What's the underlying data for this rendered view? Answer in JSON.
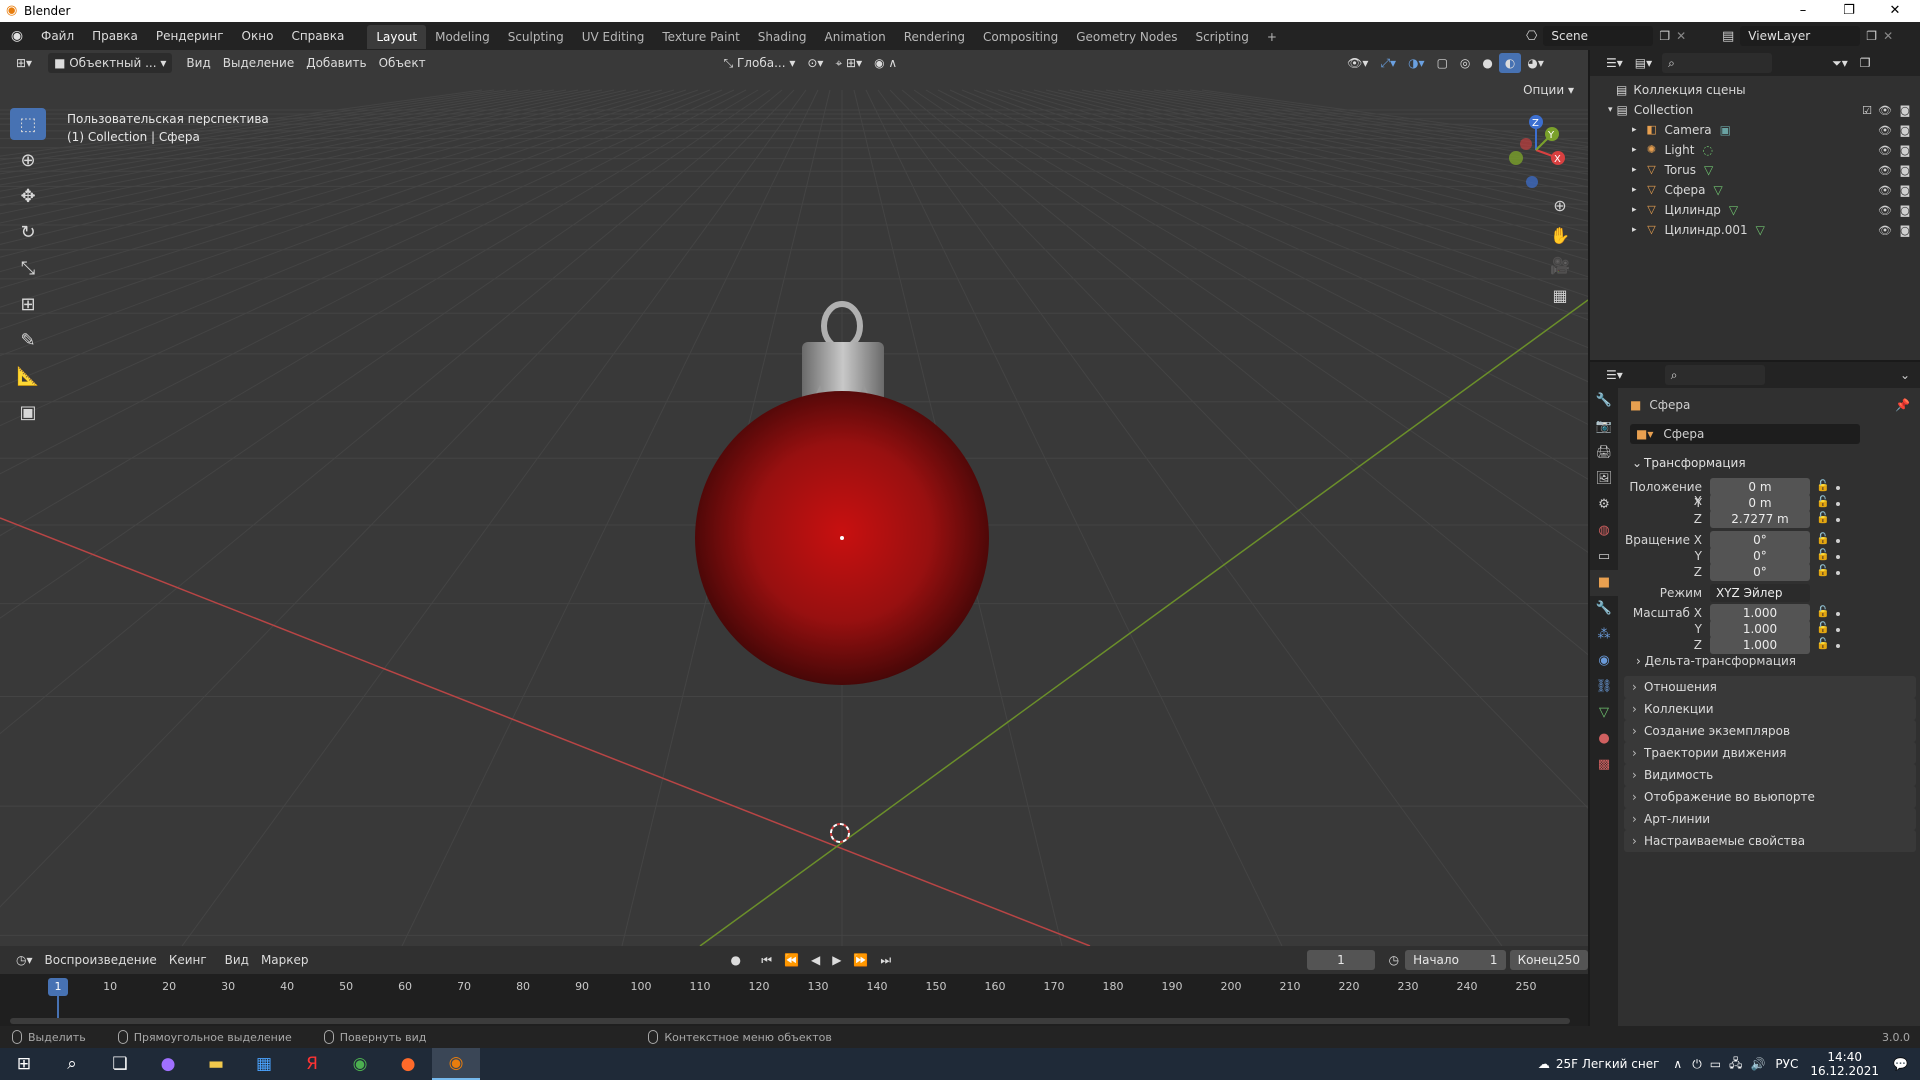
{
  "window": {
    "title": "Blender"
  },
  "menu": {
    "items": [
      "Файл",
      "Правка",
      "Рендеринг",
      "Окно",
      "Справка"
    ],
    "workspaces": [
      "Layout",
      "Modeling",
      "Sculpting",
      "UV Editing",
      "Texture Paint",
      "Shading",
      "Animation",
      "Rendering",
      "Compositing",
      "Geometry Nodes",
      "Scripting"
    ],
    "active_workspace": "Layout",
    "add_tab": "+",
    "scene": "Scene",
    "view_layer": "ViewLayer"
  },
  "viewport": {
    "mode": "Объектный ...",
    "menus": [
      "Вид",
      "Выделение",
      "Добавить",
      "Объект"
    ],
    "orientation": "Глоба...",
    "options": "Опции",
    "info_line1": "Пользовательская перспектива",
    "info_line2": "(1) Collection | Сфера",
    "colors": {
      "background": "#393939",
      "grid": "#444444",
      "x_axis": "#b84545",
      "y_axis": "#6b8f2a",
      "ornament": "#a01010"
    },
    "axis_labels": {
      "x": "X",
      "y": "Y",
      "z": "Z"
    }
  },
  "timeline": {
    "menus": [
      "Воспроизведение",
      "Кеинг",
      "Вид",
      "Маркер"
    ],
    "current_frame": "1",
    "start_label": "Начало",
    "start_value": "1",
    "end_label": "Конец",
    "end_value": "250",
    "ruler_marks": [
      "1",
      "10",
      "20",
      "30",
      "40",
      "50",
      "60",
      "70",
      "80",
      "90",
      "100",
      "110",
      "120",
      "130",
      "140",
      "150",
      "160",
      "170",
      "180",
      "190",
      "200",
      "210",
      "220",
      "230",
      "240",
      "250"
    ]
  },
  "statusbar": {
    "items": [
      "Выделить",
      "Прямоугольное выделение",
      "Повернуть вид",
      "Контекстное меню объектов"
    ],
    "version": "3.0.0"
  },
  "outliner": {
    "root": "Коллекция сцены",
    "collection": "Collection",
    "objects": [
      {
        "name": "Camera",
        "icon": "camera-icon",
        "color": "#e8a050"
      },
      {
        "name": "Light",
        "icon": "light-icon",
        "color": "#e8a050"
      },
      {
        "name": "Torus",
        "icon": "mesh-icon",
        "color": "#e8a050"
      },
      {
        "name": "Сфера",
        "icon": "mesh-icon",
        "color": "#e8a050"
      },
      {
        "name": "Цилиндр",
        "icon": "mesh-icon",
        "color": "#e8a050"
      },
      {
        "name": "Цилиндр.001",
        "icon": "mesh-icon",
        "color": "#e8a050"
      }
    ]
  },
  "properties": {
    "object_name": "Сфера",
    "object_field": "Сфера",
    "transform_title": "Трансформация",
    "location_label": "Положение X",
    "location": {
      "x": "0 m",
      "y": "0 m",
      "z": "2.7277 m"
    },
    "rotation_label": "Вращение X",
    "rotation": {
      "x": "0°",
      "y": "0°",
      "z": "0°"
    },
    "mode_label": "Режим",
    "mode_value": "XYZ Эйлер",
    "scale_label": "Масштаб X",
    "scale": {
      "x": "1.000",
      "y": "1.000",
      "z": "1.000"
    },
    "y_label": "Y",
    "z_label": "Z",
    "delta": "Дельта-трансформация",
    "panels": [
      "Отношения",
      "Коллекции",
      "Создание экземпляров",
      "Траектории движения",
      "Видимость",
      "Отображение во вьюпорте",
      "Арт-линии",
      "Настраиваемые свойства"
    ]
  },
  "taskbar": {
    "weather": "25F Легкий снег",
    "lang": "РУС",
    "time": "14:40",
    "date": "16.12.2021"
  }
}
